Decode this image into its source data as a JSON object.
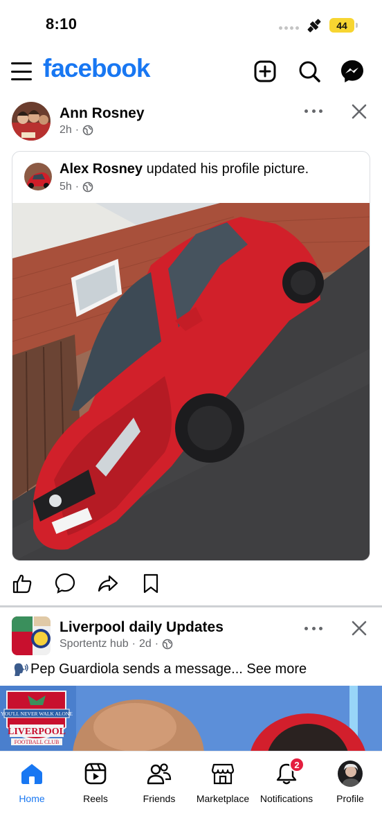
{
  "status_bar": {
    "time": "8:10",
    "battery": "44",
    "icons": [
      "signal-dots-icon",
      "satellite-icon",
      "battery-icon"
    ]
  },
  "header": {
    "logo": "facebook",
    "icons": [
      "menu-icon",
      "create-icon",
      "search-icon",
      "messenger-icon"
    ]
  },
  "posts": [
    {
      "author": "Ann Rosney",
      "time": "2h",
      "separator": "·",
      "shared": {
        "author": "Alex Rosney",
        "action_text": " updated his profile picture.",
        "time": "5h",
        "separator": "·"
      },
      "actions": [
        "like-icon",
        "comment-icon",
        "share-icon",
        "save-icon"
      ]
    },
    {
      "author": "Liverpool daily Updates",
      "sub_author": "Sportentz hub",
      "time": "2d",
      "separator": "·",
      "text": "Pep Guardiola sends a message... See more",
      "image_text": {
        "motto": "YOU'LL NEVER WALK ALONE",
        "club": "LIVERPOOL",
        "subtitle": "FOOTBALL CLUB"
      }
    }
  ],
  "bottom_nav": {
    "items": [
      {
        "label": "Home",
        "icon": "home-icon",
        "active": true
      },
      {
        "label": "Reels",
        "icon": "reels-icon"
      },
      {
        "label": "Friends",
        "icon": "friends-icon"
      },
      {
        "label": "Marketplace",
        "icon": "marketplace-icon"
      },
      {
        "label": "Notifications",
        "icon": "bell-icon",
        "badge": "2"
      },
      {
        "label": "Profile",
        "icon": "profile-avatar"
      }
    ]
  },
  "colors": {
    "brand": "#1877f2",
    "badge": "#e41e3f",
    "secondary_text": "#65676b"
  }
}
